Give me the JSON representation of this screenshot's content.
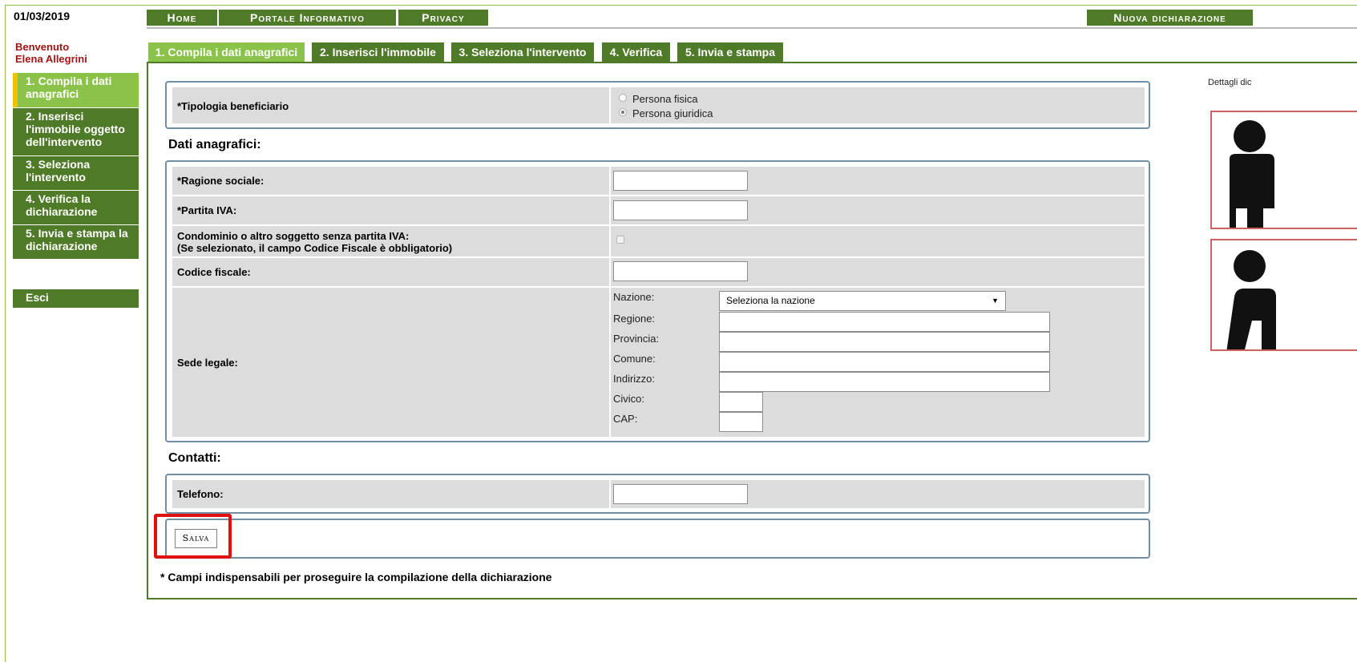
{
  "header": {
    "date": "01/03/2019",
    "nav": {
      "home": "Home",
      "portale": "Portale Informativo",
      "privacy": "Privacy",
      "nuova": "Nuova dichiarazione"
    }
  },
  "welcome": {
    "greeting": "Benvenuto",
    "user": "Elena Allegrini"
  },
  "sidebar": {
    "steps": [
      {
        "label": "1. Compila i dati anagrafici",
        "active": true
      },
      {
        "label": "2. Inserisci l'immobile oggetto dell'intervento",
        "active": false
      },
      {
        "label": "3. Seleziona l'intervento",
        "active": false
      },
      {
        "label": "4. Verifica la dichiarazione",
        "active": false
      },
      {
        "label": "5. Invia e stampa la dichiarazione",
        "active": false
      }
    ],
    "exit": "Esci"
  },
  "tabs": [
    "1. Compila i dati anagrafici",
    "2. Inserisci l'immobile",
    "3. Seleziona l'intervento",
    "4. Verifica",
    "5. Invia e stampa"
  ],
  "form": {
    "tipologia_label": "*Tipologia beneficiario",
    "options": {
      "fisica": "Persona fisica",
      "giuridica": "Persona giuridica"
    },
    "selected_option": "Persona giuridica",
    "dati_title": "Dati anagrafici:",
    "ragione_label": "*Ragione sociale:",
    "piva_label": "*Partita IVA:",
    "condominio_label_1": "Condominio o altro soggetto senza partita IVA:",
    "condominio_label_2": "(Se selezionato, il campo Codice Fiscale è obbligatorio)",
    "cf_label": "Codice fiscale:",
    "sede_label": "Sede legale:",
    "nazione_label": "Nazione:",
    "nazione_value": "Seleziona la nazione",
    "regione_label": "Regione:",
    "provincia_label": "Provincia:",
    "comune_label": "Comune:",
    "indirizzo_label": "Indirizzo:",
    "civico_label": "Civico:",
    "cap_label": "CAP:",
    "contatti_title": "Contatti:",
    "telefono_label": "Telefono:",
    "save": "Salva",
    "footnote": "* Campi indispensabili per proseguire la compilazione della dichiarazione"
  },
  "right_panel": {
    "details": "Dettagli dic"
  },
  "colors": {
    "dark_green": "#4f7a28",
    "light_green": "#8bc34a",
    "highlight": "#e01010"
  }
}
